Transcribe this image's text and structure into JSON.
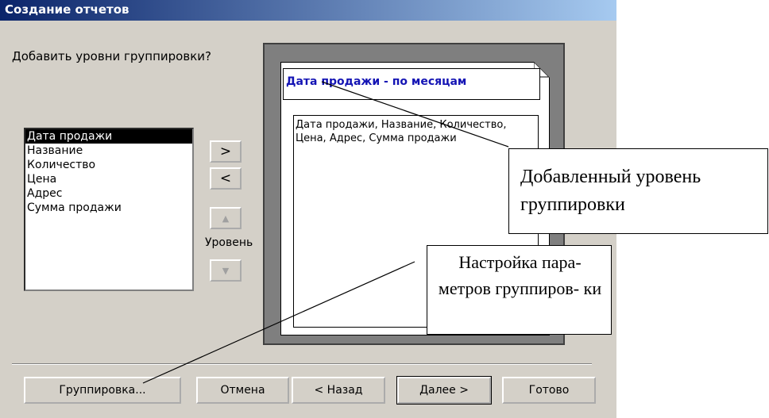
{
  "window": {
    "title": "Создание отчетов"
  },
  "prompt": "Добавить уровни группировки?",
  "fields": [
    "Дата продажи",
    "Название",
    "Количество",
    "Цена",
    "Адрес",
    "Сумма продажи"
  ],
  "selected_index": 0,
  "controls": {
    "add_label": ">",
    "remove_label": "<",
    "level_label": "Уровень",
    "up_icon": "arrow-up-icon",
    "down_icon": "arrow-down-icon"
  },
  "preview": {
    "group_header": "Дата продажи - по месяцам",
    "detail_fields": "Дата продажи, Название, Количество, Цена, Адрес, Сумма продажи"
  },
  "buttons": {
    "grouping": "Группировка...",
    "cancel": "Отмена",
    "back": "< Назад",
    "next": "Далее >",
    "finish": "Готово"
  },
  "callouts": {
    "added_level": "Добавленный уровень группировки",
    "grouping_settings": "Настройка пара- метров группиров- ки"
  },
  "colors": {
    "title_bar": "#0a246a",
    "window_bg": "#d4d0c8",
    "group_header_text": "#1414b4",
    "selection": "#000000"
  }
}
